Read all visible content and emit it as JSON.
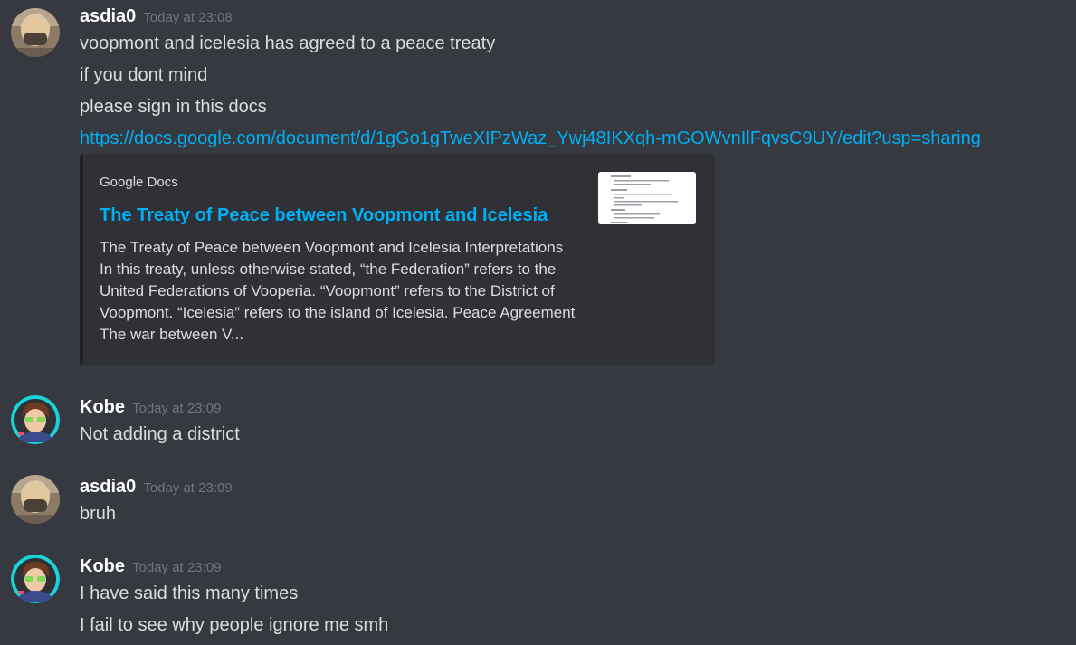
{
  "messages": [
    {
      "username": "asdia0",
      "timestamp": "Today at 23:08",
      "lines": [
        "voopmont and icelesia has agreed to a peace treaty",
        "if you dont mind",
        "please sign in this docs"
      ],
      "link": "https://docs.google.com/document/d/1gGo1gTweXIPzWaz_Ywj48IKXqh-mGOWvnIlFqvsC9UY/edit?usp=sharing",
      "embed": {
        "provider": "Google Docs",
        "title": "The Treaty of Peace between Voopmont and Icelesia",
        "description": "The Treaty of Peace between Voopmont and Icelesia Interpretations In this treaty, unless otherwise stated, “the Federation” refers to the United Federations of Vooperia. “Voopmont” refers to the District of Voopmont. “Icelesia” refers to the island of Icelesia. Peace Agreement The war between V..."
      }
    },
    {
      "username": "Kobe",
      "timestamp": "Today at 23:09",
      "lines": [
        "Not adding a district"
      ]
    },
    {
      "username": "asdia0",
      "timestamp": "Today at 23:09",
      "lines": [
        "bruh"
      ]
    },
    {
      "username": "Kobe",
      "timestamp": "Today at 23:09",
      "lines": [
        "I have said this many times",
        "I fail to see why people ignore me smh"
      ]
    }
  ],
  "colors": {
    "background": "#36393f",
    "embed_background": "#2f3136",
    "link": "#00aff4",
    "username": "#ffffff",
    "timestamp": "#72767d",
    "text": "#dcddde"
  }
}
